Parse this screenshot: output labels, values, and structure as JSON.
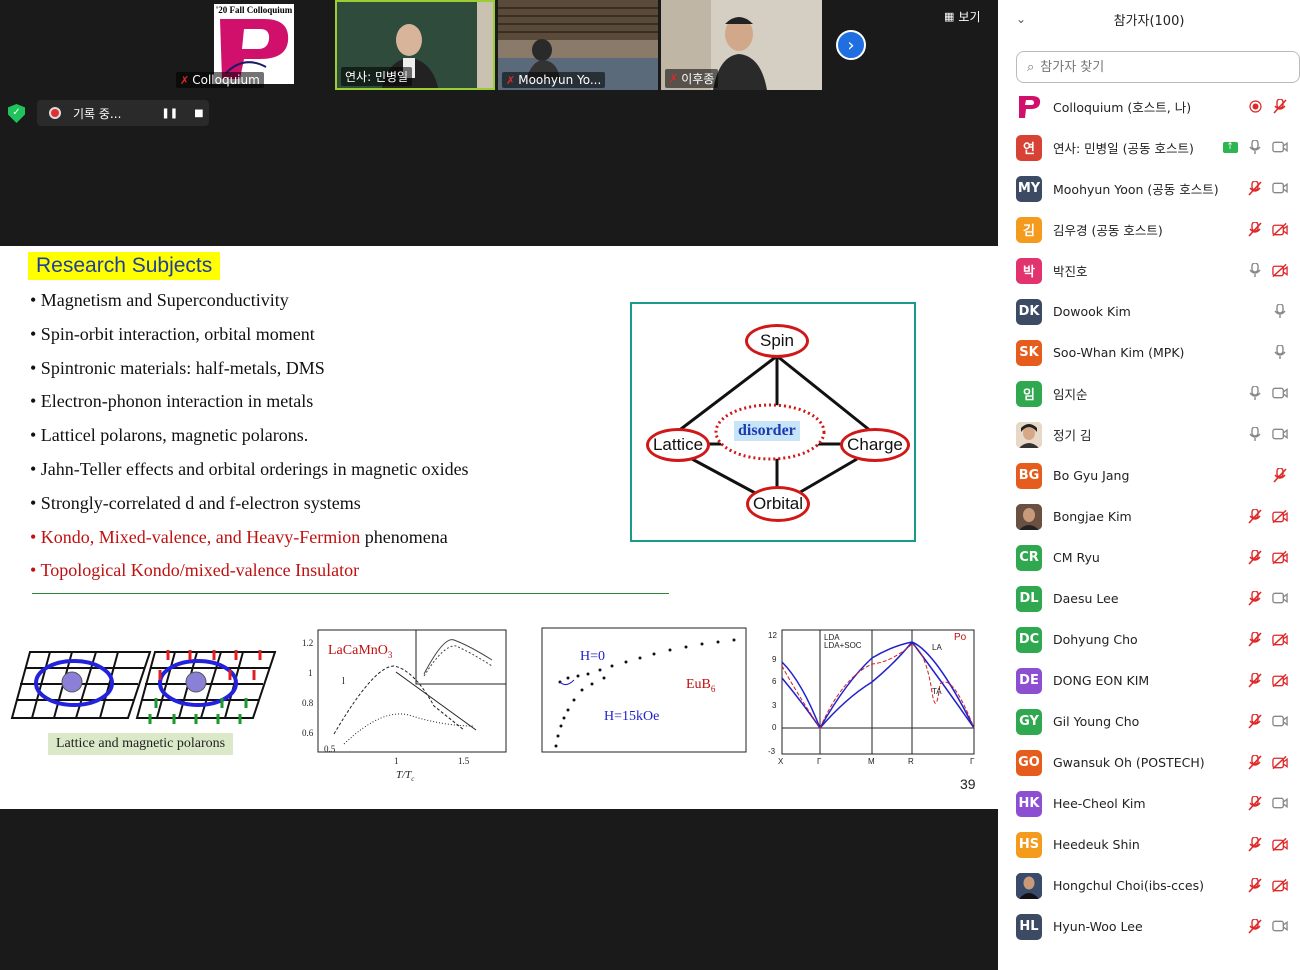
{
  "video_strip": {
    "tiles": [
      {
        "name": "Colloquium",
        "muted": true,
        "logo_text": "'20 Fall Colloquium"
      },
      {
        "name": "연사: 민병일",
        "muted": false
      },
      {
        "name": "Moohyun Yo...",
        "muted": true
      },
      {
        "name": "이후종",
        "muted": true
      }
    ],
    "view_label": "보기",
    "recording_label": "기록 중..."
  },
  "slide": {
    "title": "Research Subjects",
    "bullets": [
      "• Magnetism and Superconductivity",
      "• Spin-orbit interaction, orbital moment",
      "• Spintronic materials: half-metals, DMS",
      "• Electron-phonon interaction in metals",
      "• Latticel polarons, magnetic polarons.",
      "• Jahn-Teller effects and orbital orderings in magnetic oxides",
      "• Strongly-correlated d and f-electron systems"
    ],
    "bullet_red_1": "• Kondo, Mixed-valence, and Heavy-Fermion",
    "bullet_red_1_tail": " phenomena",
    "bullet_red_2": "• Topological Kondo/mixed-valence Insulator",
    "diagram": {
      "top": "Spin",
      "left": "Lattice",
      "right": "Charge",
      "bottom": "Orbital",
      "center": "disorder"
    },
    "polaron_label": "Lattice and magnetic polarons",
    "fig1_label": "LaCaMnO",
    "fig1_sub": "3",
    "fig1_xlabel": "T/T",
    "fig1_xsub": "c",
    "fig1_low": "l",
    "fig1_xticks": [
      "0.5",
      "1",
      "1.5"
    ],
    "fig1_yticks": [
      "1.2",
      "1",
      "0.8",
      "0.6"
    ],
    "fig2_label": "EuB",
    "fig2_sub": "6",
    "fig2_h0": "H=0",
    "fig2_h15": "H=15kOe",
    "fig3_yticks": [
      "12",
      "9",
      "6",
      "3",
      "0",
      "-3"
    ],
    "fig3_xticks": [
      "X",
      "Γ",
      "M",
      "R",
      "Γ"
    ],
    "fig3_legend": [
      "LDA",
      "LDA+SOC"
    ],
    "fig3_tag": "Po",
    "fig3_la": "LA",
    "fig3_ta": "TA",
    "page_number": "39"
  },
  "panel": {
    "title": "참가자(100)",
    "search_placeholder": "참가자 찾기",
    "participants": [
      {
        "initials": "",
        "name": "Colloquium (호스트, 나)",
        "color": "#ffffff",
        "icons": [
          "record-icon",
          "mic-muted-icon"
        ]
      },
      {
        "initials": "연",
        "name": "연사: 민병일 (공동 호스트)",
        "color": "#d84235",
        "icons": [
          "share-icon",
          "mic-icon",
          "video-icon"
        ]
      },
      {
        "initials": "MY",
        "name": "Moohyun Yoon (공동 호스트)",
        "color": "#3c4b63",
        "icons": [
          "mic-muted-icon",
          "video-icon"
        ]
      },
      {
        "initials": "김",
        "name": "김우경 (공동 호스트)",
        "color": "#f49a1c",
        "icons": [
          "mic-muted-icon",
          "video-off-icon"
        ]
      },
      {
        "initials": "박",
        "name": "박진호",
        "color": "#e2336e",
        "icons": [
          "mic-icon",
          "video-off-icon"
        ]
      },
      {
        "initials": "DK",
        "name": "Dowook Kim",
        "color": "#3c4b63",
        "icons": [
          "mic-icon"
        ]
      },
      {
        "initials": "SK",
        "name": "Soo-Whan Kim (MPK)",
        "color": "#e65c1c",
        "icons": [
          "mic-icon"
        ]
      },
      {
        "initials": "임",
        "name": "임지순",
        "color": "#2fa84f",
        "icons": [
          "mic-icon",
          "video-icon"
        ]
      },
      {
        "initials": "",
        "name": "정기 김",
        "color": "#b98c6e",
        "icons": [
          "mic-icon",
          "video-icon"
        ]
      },
      {
        "initials": "BG",
        "name": "Bo Gyu Jang",
        "color": "#e65c1c",
        "icons": [
          "mic-muted-icon"
        ]
      },
      {
        "initials": "",
        "name": "Bongjae Kim",
        "color": "#7a5a45",
        "icons": [
          "mic-muted-icon",
          "video-off-icon"
        ]
      },
      {
        "initials": "CR",
        "name": "CM Ryu",
        "color": "#2fa84f",
        "icons": [
          "mic-muted-icon",
          "video-off-icon"
        ]
      },
      {
        "initials": "DL",
        "name": "Daesu Lee",
        "color": "#2fa84f",
        "icons": [
          "mic-muted-icon",
          "video-icon"
        ]
      },
      {
        "initials": "DC",
        "name": "Dohyung Cho",
        "color": "#2fa84f",
        "icons": [
          "mic-muted-icon",
          "video-off-icon"
        ]
      },
      {
        "initials": "DE",
        "name": "DONG EON KIM",
        "color": "#8c4fd1",
        "icons": [
          "mic-muted-icon",
          "video-off-icon"
        ]
      },
      {
        "initials": "GY",
        "name": "Gil Young Cho",
        "color": "#2fa84f",
        "icons": [
          "mic-muted-icon",
          "video-icon"
        ]
      },
      {
        "initials": "GO",
        "name": "Gwansuk Oh (POSTECH)",
        "color": "#e65c1c",
        "icons": [
          "mic-muted-icon",
          "video-off-icon"
        ]
      },
      {
        "initials": "HK",
        "name": "Hee-Cheol Kim",
        "color": "#8c4fd1",
        "icons": [
          "mic-muted-icon",
          "video-icon"
        ]
      },
      {
        "initials": "HS",
        "name": "Heedeuk Shin",
        "color": "#f49a1c",
        "icons": [
          "mic-muted-icon",
          "video-off-icon"
        ]
      },
      {
        "initials": "",
        "name": "Hongchul Choi(ibs-cces)",
        "color": "#2a3550",
        "icons": [
          "mic-muted-icon",
          "video-off-icon"
        ]
      },
      {
        "initials": "HL",
        "name": "Hyun-Woo Lee",
        "color": "#3c4b63",
        "icons": [
          "mic-muted-icon",
          "video-icon"
        ]
      }
    ]
  }
}
